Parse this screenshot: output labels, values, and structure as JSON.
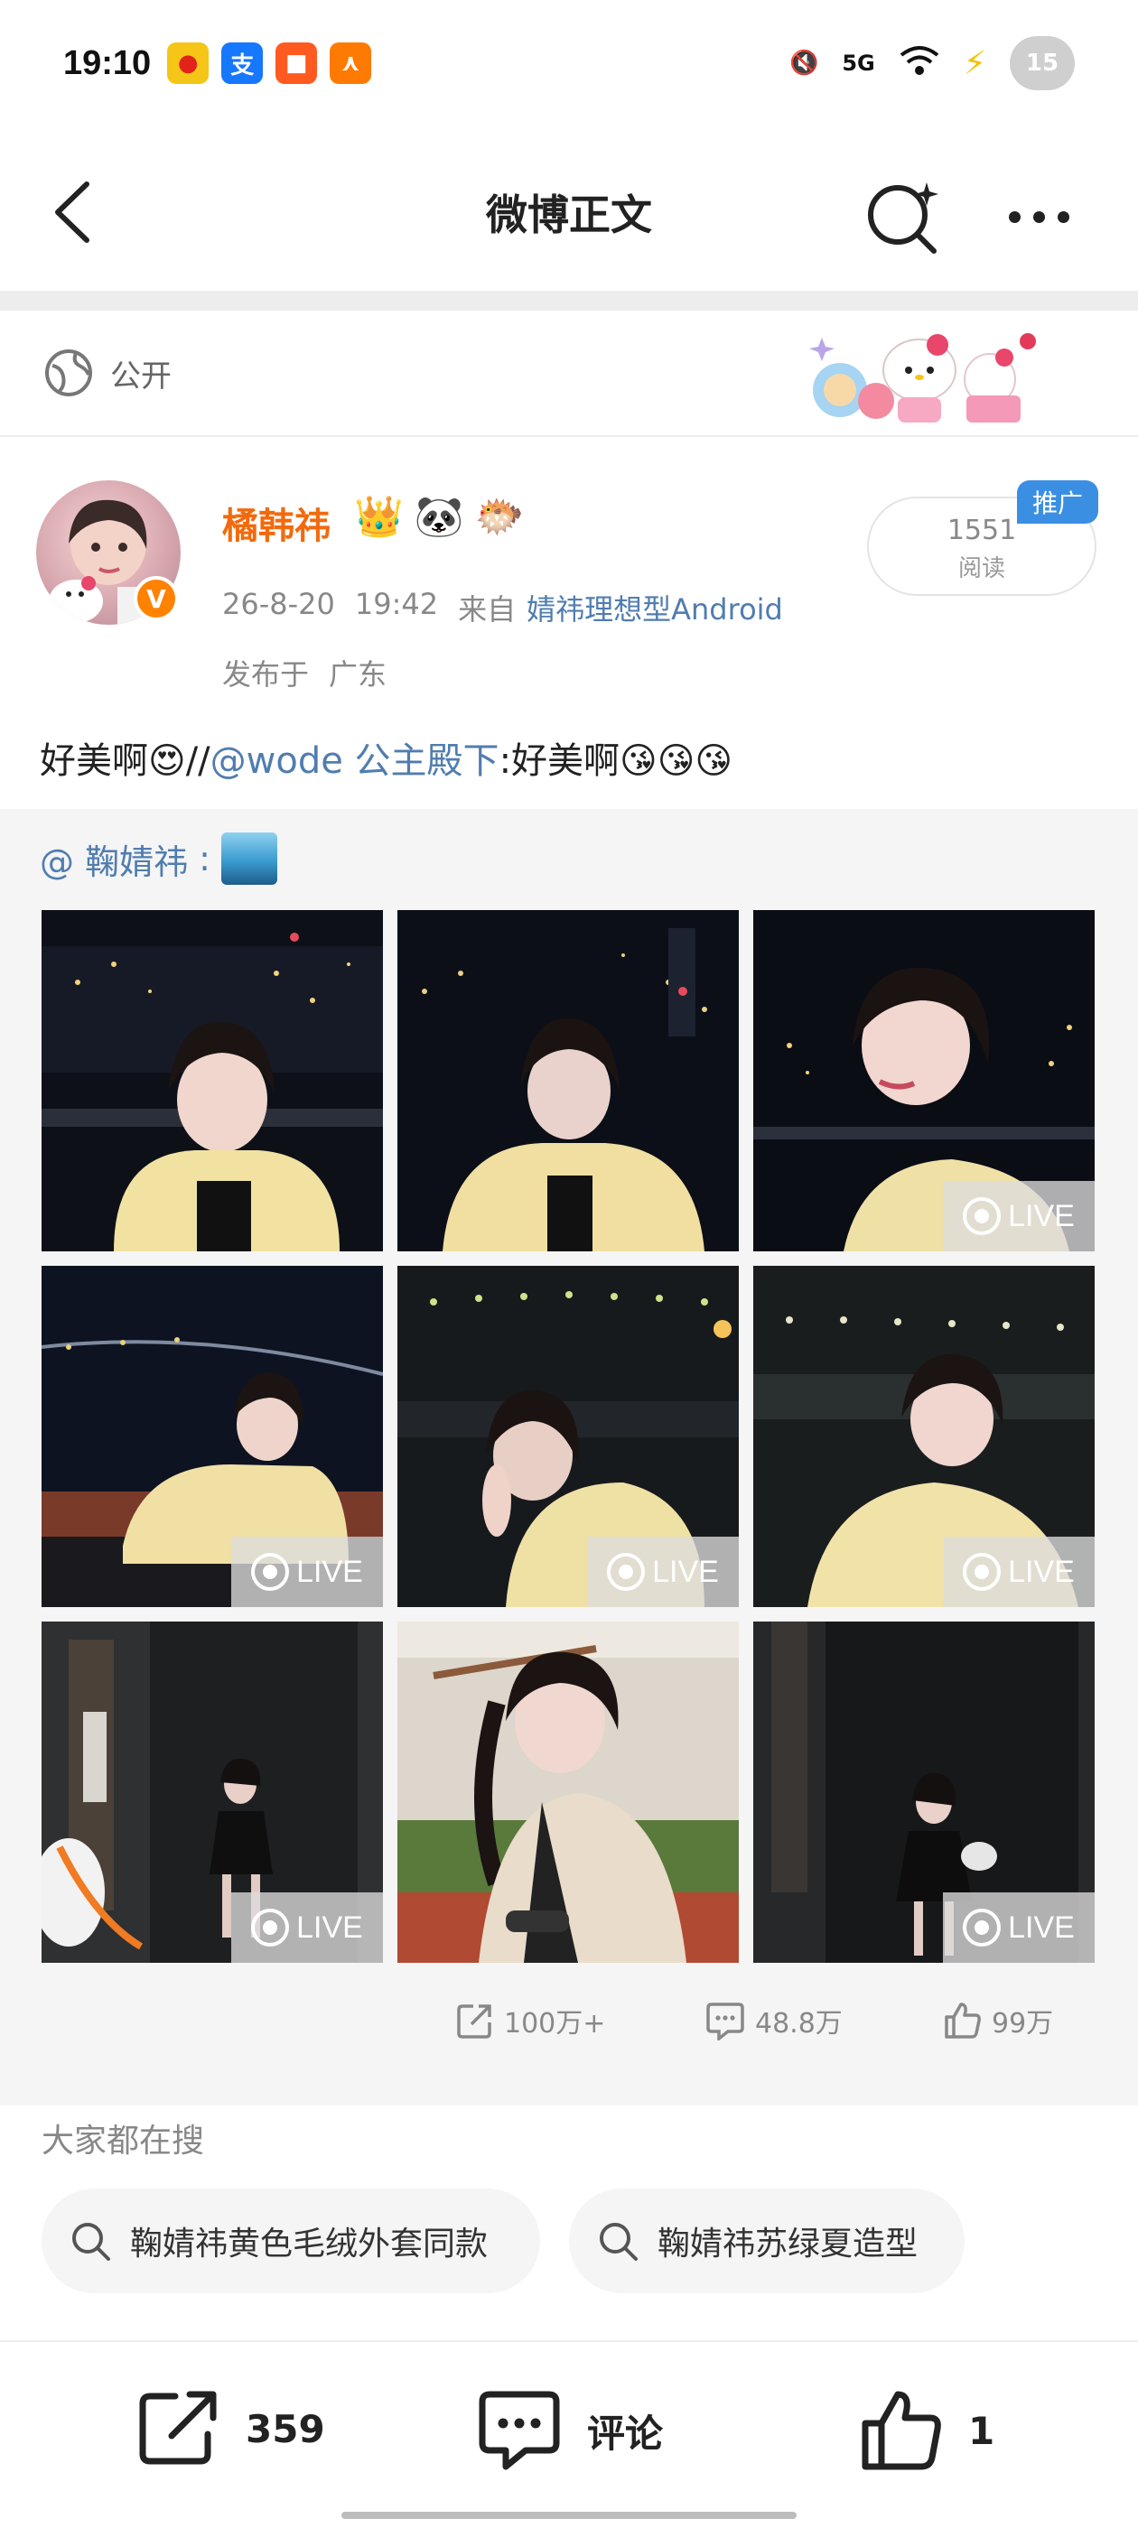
{
  "status_bar": {
    "time": "19:10",
    "network": "5G",
    "battery": "15",
    "apps": [
      "weibo-icon",
      "alipay-icon",
      "app-icon",
      "orange-app-icon"
    ]
  },
  "nav": {
    "title": "微博正文"
  },
  "visibility": {
    "label": "公开"
  },
  "author": {
    "name": "橘韩祎",
    "emojis": [
      "👑",
      "🐼",
      "🐡"
    ],
    "date": "26-8-20",
    "time": "19:42",
    "from_label": "来自",
    "source": "婧祎理想型Android",
    "location_label": "发布于",
    "location": "广东",
    "verified_badge": "V"
  },
  "reads": {
    "count": "1551",
    "label": "阅读",
    "promo_tag": "推广"
  },
  "post": {
    "text_prefix": "好美啊😍//",
    "mention": "@wode 公主殿下",
    "text_suffix": ":好美啊😘😘😘"
  },
  "retweet": {
    "author": "@ 鞠婧祎",
    "colon": " :",
    "tiles": [
      {
        "live": false
      },
      {
        "live": false
      },
      {
        "live": true,
        "label": "LIVE"
      },
      {
        "live": true,
        "label": "LIVE"
      },
      {
        "live": true,
        "label": "LIVE"
      },
      {
        "live": true,
        "label": "LIVE"
      },
      {
        "live": true,
        "label": "LIVE"
      },
      {
        "live": false
      },
      {
        "live": true,
        "label": "LIVE"
      }
    ],
    "actions": {
      "repost": "100万+",
      "comment": "48.8万",
      "like": "99万"
    }
  },
  "hot_search": {
    "title": "大家都在搜",
    "chips": [
      "鞠婧祎黄色毛绒外套同款",
      "鞠婧祎苏绿夏造型"
    ]
  },
  "bottom_bar": {
    "repost_count": "359",
    "comment_label": "评论",
    "like_count": "1"
  },
  "colors": {
    "link": "#507daf",
    "author_name": "#f26a0d",
    "promo": "#3a8fe3"
  }
}
